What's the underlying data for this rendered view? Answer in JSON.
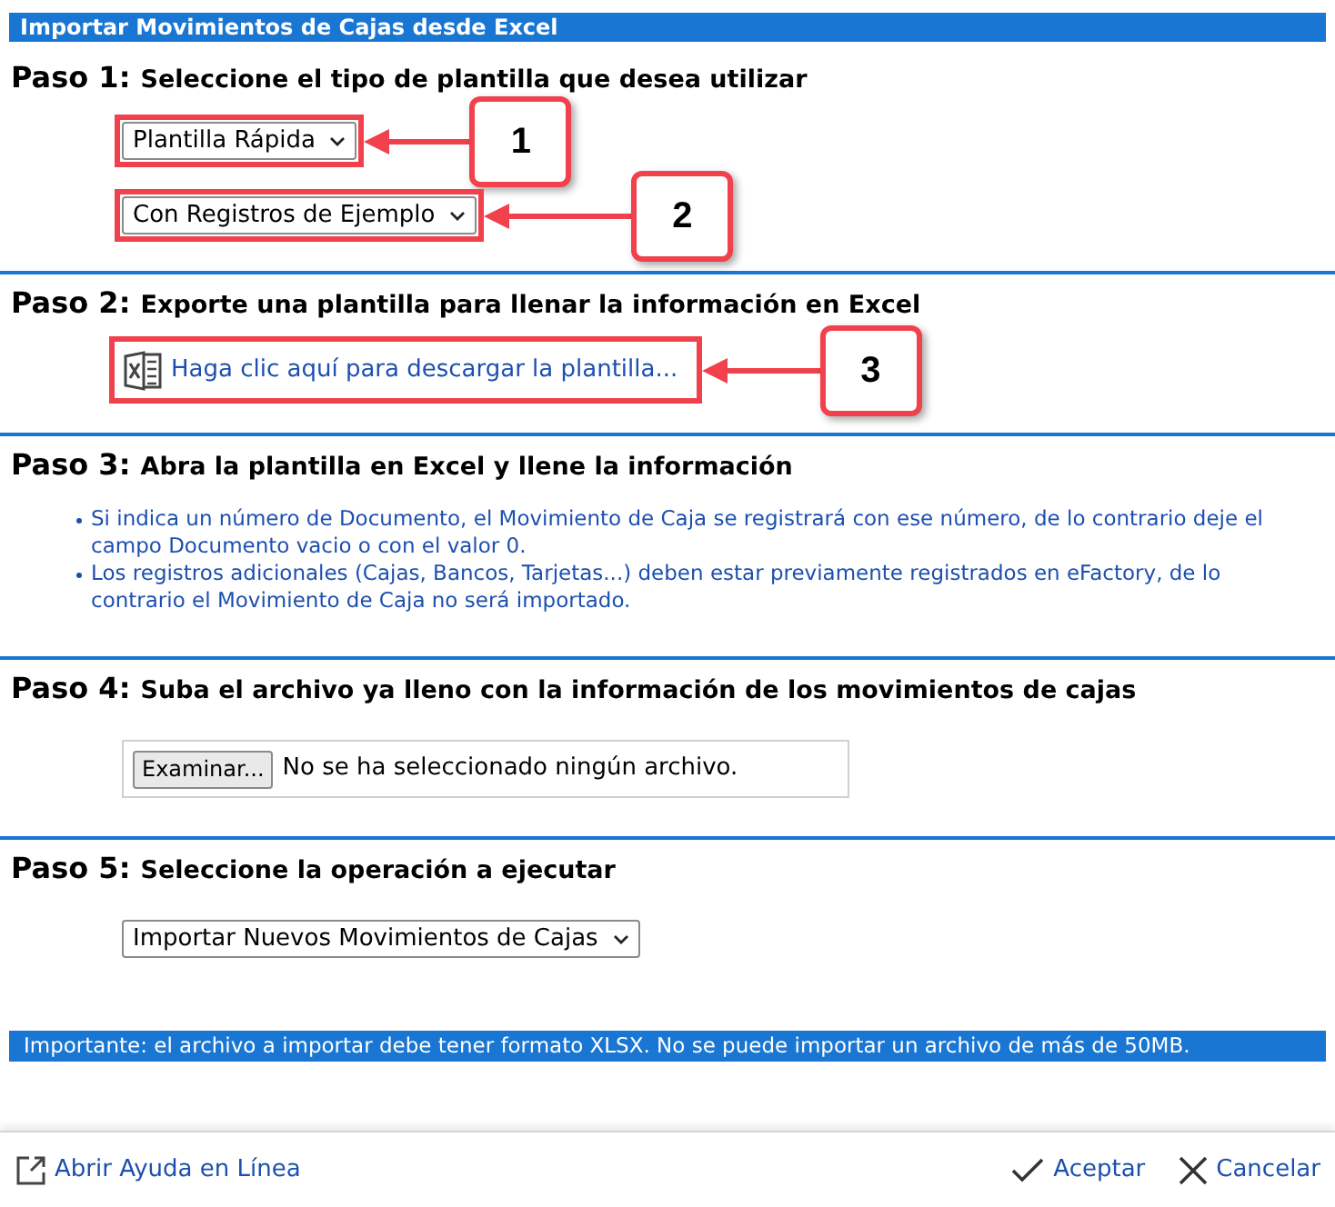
{
  "window": {
    "title": "Importar Movimientos de Cajas desde Excel"
  },
  "steps": [
    {
      "kind": "selects",
      "number": "Paso 1:",
      "title": "Seleccione el tipo de plantilla que desea utilizar",
      "selects": [
        {
          "value": "Plantilla Rápida",
          "callout": "1"
        },
        {
          "value": "Con Registros de Ejemplo",
          "callout": "2"
        }
      ]
    },
    {
      "kind": "link",
      "number": "Paso 2:",
      "title": "Exporte una plantilla para llenar la información en Excel",
      "link": {
        "text": "Haga clic aquí para descargar la plantilla...",
        "callout": "3"
      }
    },
    {
      "kind": "bullets",
      "number": "Paso 3:",
      "title": "Abra la plantilla en Excel y llene la información",
      "bullets": [
        "Si indica un número de Documento, el Movimiento de Caja se registrará con ese número, de lo contrario deje el campo Documento vacio o con el valor 0.",
        "Los registros adicionales (Cajas, Bancos, Tarjetas...) deben estar previamente registrados en eFactory, de lo contrario el Movimiento de Caja no será importado."
      ]
    },
    {
      "kind": "file",
      "number": "Paso 4:",
      "title": "Suba el archivo ya lleno con la información de los movimientos de cajas",
      "button": "Examinar...",
      "status": "No se ha seleccionado ningún archivo."
    },
    {
      "kind": "select",
      "number": "Paso 5:",
      "title": "Seleccione la operación a ejecutar",
      "value": "Importar Nuevos Movimientos de Cajas"
    }
  ],
  "notice": "Importante: el archivo a importar debe tener formato XLSX. No se puede importar un archivo de más de 50MB.",
  "footer": {
    "help_link": "Abrir Ayuda en Línea",
    "buttons": [
      {
        "kind": "accept",
        "label": "Aceptar"
      },
      {
        "kind": "cancel",
        "label": "Cancelar"
      }
    ]
  }
}
